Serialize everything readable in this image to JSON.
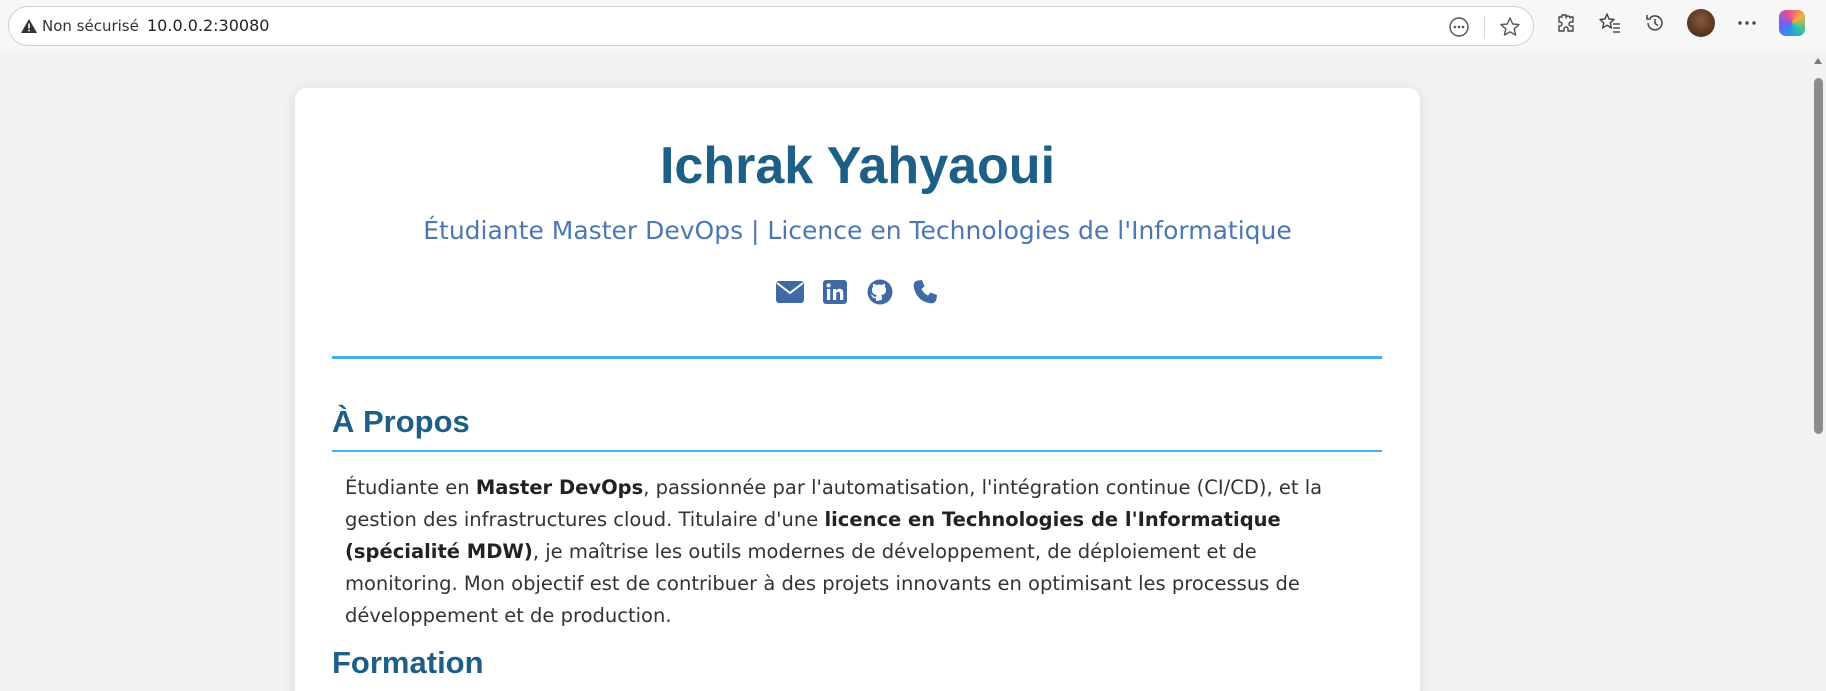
{
  "browser": {
    "security_label": "Non sécurisé",
    "url": "10.0.0.2:30080"
  },
  "profile": {
    "name": "Ichrak Yahyaoui",
    "subtitle": "Étudiante Master DevOps | Licence en Technologies de l'Informatique",
    "socials": [
      "email-icon",
      "linkedin-icon",
      "github-icon",
      "phone-icon"
    ]
  },
  "about": {
    "title": "À Propos",
    "text": {
      "p1": "Étudiante en ",
      "b1": "Master DevOps",
      "p2": ", passionnée par l'automatisation, l'intégration continue (CI/CD), et la gestion des infrastructures cloud. Titulaire d'une ",
      "b2": "licence en Technologies de l'Informatique (spécialité MDW)",
      "p3": ", je maîtrise les outils modernes de développement, de déploiement et de monitoring. Mon objectif est de contribuer à des projets innovants en optimisant les processus de développement et de production."
    }
  },
  "formation": {
    "title": "Formation"
  },
  "colors": {
    "heading": "#1d5f86",
    "subtitle": "#4c78b2",
    "accent": "#43b0ec"
  }
}
